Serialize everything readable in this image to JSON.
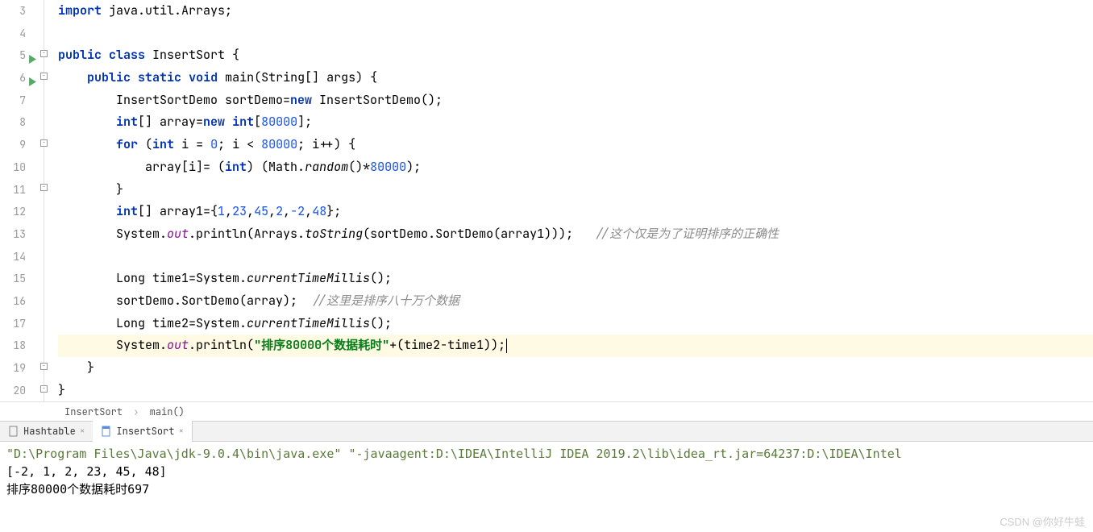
{
  "gutter": [
    "3",
    "4",
    "5",
    "6",
    "7",
    "8",
    "9",
    "10",
    "11",
    "12",
    "13",
    "14",
    "15",
    "16",
    "17",
    "18",
    "19",
    "20"
  ],
  "code": {
    "l3": {
      "import": "import",
      "pkg": " java.util.Arrays;"
    },
    "l5": {
      "public": "public",
      "class": "class",
      "name": " InsertSort {"
    },
    "l6": {
      "indent": "    ",
      "public": "public",
      "static": "static",
      "void": "void",
      "sig": " main(String[] args) {"
    },
    "l7": {
      "indent": "        ",
      "a": "InsertSortDemo sortDemo=",
      "new": "new",
      "b": " InsertSortDemo();"
    },
    "l8": {
      "indent": "        ",
      "int": "int",
      "a": "[] array=",
      "new": "new",
      "int2": "int",
      "b": "[",
      "n": "80000",
      "c": "];"
    },
    "l9": {
      "indent": "        ",
      "for": "for",
      "a": " (",
      "int": "int",
      "b": " i = ",
      "z": "0",
      "c": "; i < ",
      "n": "80000",
      "d": "; i++) {"
    },
    "l10": {
      "indent": "            ",
      "a": "array[i]= (",
      "int": "int",
      "b": ") (Math.",
      "rnd": "random",
      "c": "()*",
      "n": "80000",
      "d": ");"
    },
    "l11": {
      "indent": "        ",
      "a": "}"
    },
    "l12": {
      "indent": "        ",
      "int": "int",
      "a": "[] array1={",
      "n1": "1",
      "c1": ",",
      "n2": "23",
      "c2": ",",
      "n3": "45",
      "c3": ",",
      "n4": "2",
      "c4": ",",
      "n5": "-2",
      "c5": ",",
      "n6": "48",
      "b": "};"
    },
    "l13": {
      "indent": "        ",
      "a": "System.",
      "out": "out",
      "b": ".println(Arrays.",
      "ts": "toString",
      "c": "(sortDemo.SortDemo(array1)));   ",
      "cm": "//这个仅是为了证明排序的正确性"
    },
    "l15": {
      "indent": "        ",
      "a": "Long time1=System.",
      "m": "currentTimeMillis",
      "b": "();"
    },
    "l16": {
      "indent": "        ",
      "a": "sortDemo.SortDemo(array);  ",
      "cm": "//这里是排序八十万个数据"
    },
    "l17": {
      "indent": "        ",
      "a": "Long time2=System.",
      "m": "currentTimeMillis",
      "b": "();"
    },
    "l18": {
      "indent": "        ",
      "a": "System.",
      "out": "out",
      "b": ".println(",
      "s": "\"排序80000个数据耗时\"",
      "c": "+(time2-time1));"
    },
    "l19": {
      "indent": "    ",
      "a": "}"
    },
    "l20": {
      "a": "}"
    }
  },
  "breadcrumb": {
    "c1": "InsertSort",
    "c2": "main()"
  },
  "tabs": {
    "t1": "Hashtable",
    "t2": "InsertSort"
  },
  "console": {
    "cmd": "\"D:\\Program Files\\Java\\jdk-9.0.4\\bin\\java.exe\" \"-javaagent:D:\\IDEA\\IntelliJ IDEA 2019.2\\lib\\idea_rt.jar=64237:D:\\IDEA\\Intel",
    "out1": "[-2, 1, 2, 23, 45, 48]",
    "out2": "排序80000个数据耗时697"
  },
  "watermark": "CSDN @你好牛蛙"
}
